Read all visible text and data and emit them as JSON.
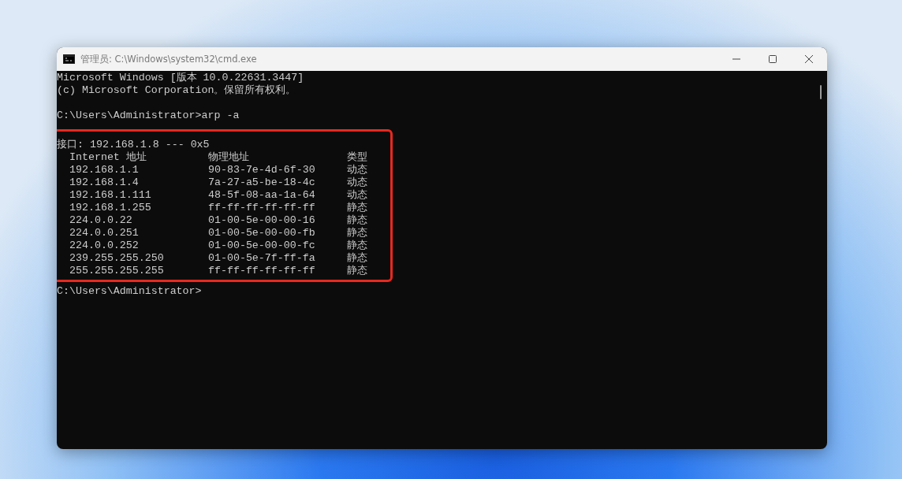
{
  "window": {
    "title": "管理员: C:\\Windows\\system32\\cmd.exe"
  },
  "console": {
    "header_lines": [
      "Microsoft Windows [版本 10.0.22631.3447]",
      "(c) Microsoft Corporation。保留所有权利。"
    ],
    "command_line": "C:\\Users\\Administrator>arp -a",
    "arp_output": {
      "interface_line": "接口: 192.168.1.8 --- 0x5",
      "columns": [
        "Internet 地址",
        "物理地址",
        "类型"
      ],
      "rows": [
        {
          "address": "192.168.1.1",
          "mac": "90-83-7e-4d-6f-30",
          "type": "动态"
        },
        {
          "address": "192.168.1.4",
          "mac": "7a-27-a5-be-18-4c",
          "type": "动态"
        },
        {
          "address": "192.168.1.111",
          "mac": "48-5f-08-aa-1a-64",
          "type": "动态"
        },
        {
          "address": "192.168.1.255",
          "mac": "ff-ff-ff-ff-ff-ff",
          "type": "静态"
        },
        {
          "address": "224.0.0.22",
          "mac": "01-00-5e-00-00-16",
          "type": "静态"
        },
        {
          "address": "224.0.0.251",
          "mac": "01-00-5e-00-00-fb",
          "type": "静态"
        },
        {
          "address": "224.0.0.252",
          "mac": "01-00-5e-00-00-fc",
          "type": "静态"
        },
        {
          "address": "239.255.255.250",
          "mac": "01-00-5e-7f-ff-fa",
          "type": "静态"
        },
        {
          "address": "255.255.255.255",
          "mac": "ff-ff-ff-ff-ff-ff",
          "type": "静态"
        }
      ]
    },
    "prompt": "C:\\Users\\Administrator>"
  }
}
